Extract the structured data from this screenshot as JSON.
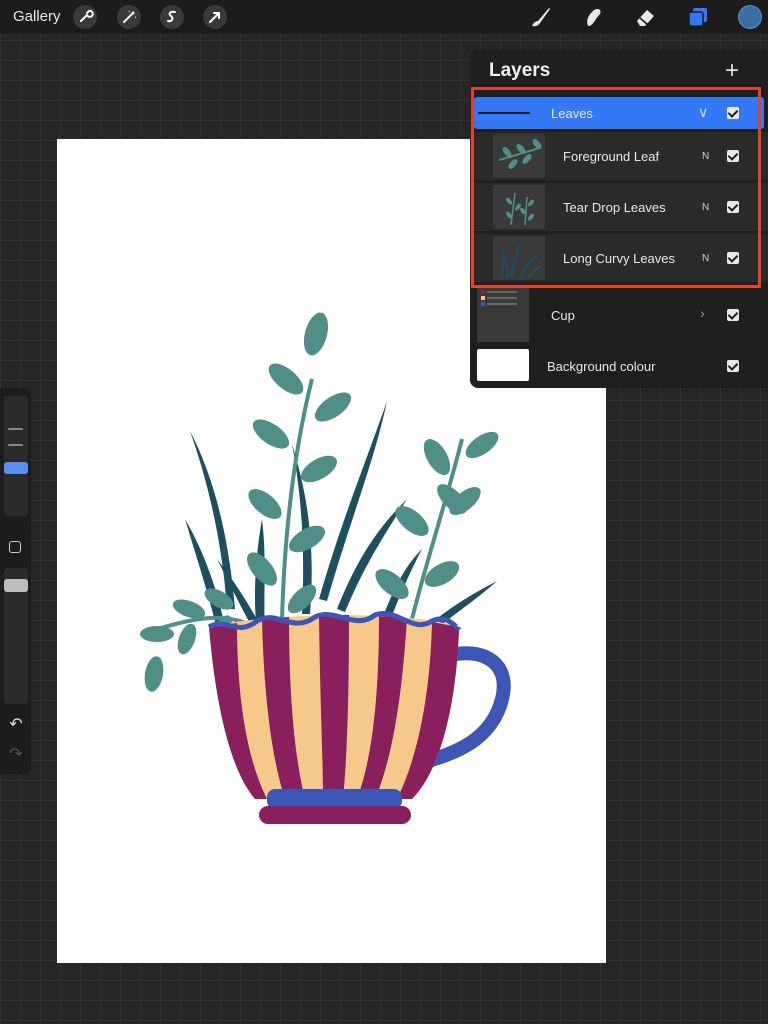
{
  "toolbar": {
    "gallery_label": "Gallery",
    "left_tools": [
      "wrench-icon",
      "magic-wand-icon",
      "selection-icon",
      "transform-icon"
    ],
    "right_tools": [
      "brush-icon",
      "smudge-icon",
      "eraser-icon",
      "layers-icon",
      "color-swatch"
    ],
    "current_color": "#3b6ea5"
  },
  "layers_panel": {
    "title": "Layers",
    "add_icon": "plus-icon",
    "groups": [
      {
        "name": "Leaves",
        "selected": true,
        "expanded": true,
        "visible": true,
        "children": [
          {
            "name": "Foreground Leaf",
            "blend": "N",
            "visible": true
          },
          {
            "name": "Tear Drop Leaves",
            "blend": "N",
            "visible": true
          },
          {
            "name": "Long Curvy Leaves",
            "blend": "N",
            "visible": true
          }
        ]
      },
      {
        "name": "Cup",
        "selected": false,
        "expanded": false,
        "visible": true
      }
    ],
    "background": {
      "name": "Background colour",
      "visible": true
    }
  },
  "sidebar": {
    "undo_icon": "undo-icon",
    "redo_icon": "redo-icon"
  },
  "colors": {
    "accent": "#3478f6",
    "highlight_border": "#e0432c",
    "leaf_teal": "#4f8f86",
    "leaf_dark": "#1f4f5f",
    "cup_purple": "#8a1f5e",
    "cup_peach": "#f6c88a",
    "cup_blue": "#3d55b4"
  }
}
